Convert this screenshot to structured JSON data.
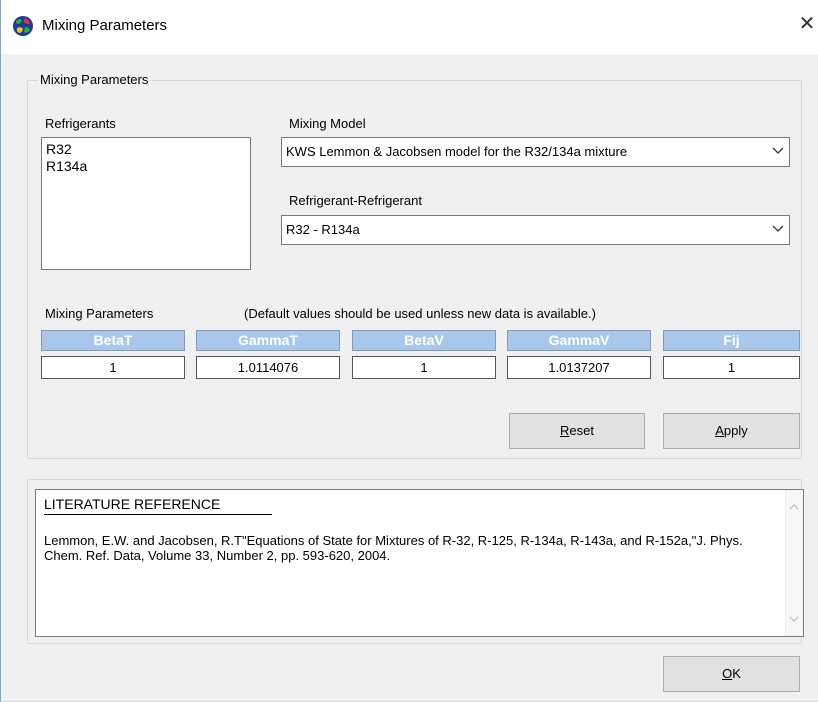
{
  "window": {
    "title": "Mixing Parameters",
    "close_glyph": "✕"
  },
  "group": {
    "label": "Mixing Parameters"
  },
  "refrigerants": {
    "label": "Refrigerants",
    "items": [
      "R32",
      "R134a"
    ]
  },
  "mixing_model": {
    "label": "Mixing Model",
    "value": "KWS  Lemmon & Jacobsen model for the R32/134a mixture"
  },
  "pair": {
    "label": "Refrigerant-Refrigerant",
    "value": "R32 - R134a"
  },
  "params": {
    "label": "Mixing Parameters",
    "note": "(Default values should be used unless new data is available.)",
    "columns": [
      {
        "header": "BetaT",
        "value": "1"
      },
      {
        "header": "GammaT",
        "value": "1.0114076"
      },
      {
        "header": "BetaV",
        "value": "1"
      },
      {
        "header": "GammaV",
        "value": "1.0137207"
      },
      {
        "header": "Fij",
        "value": "1"
      }
    ]
  },
  "buttons": {
    "reset": {
      "mnemonic": "R",
      "rest": "eset"
    },
    "apply": {
      "mnemonic": "A",
      "rest": "pply"
    },
    "ok": {
      "mnemonic": "O",
      "rest": "K"
    }
  },
  "reference": {
    "title": "LITERATURE REFERENCE",
    "text": "Lemmon, E.W. and Jacobsen, R.T\"Equations of State for Mixtures of R-32, R-125, R-134a, R-143a, and R-152a,\"J. Phys. Chem. Ref. Data, Volume 33, Number 2, pp. 593-620, 2004."
  },
  "icons": {
    "app": "globe-icon",
    "dropdown": "chevron-down-icon",
    "scroll_up": "scroll-up-icon",
    "scroll_down": "scroll-down-icon"
  },
  "colors": {
    "param_header_bg": "#a9c7ea",
    "param_header_text": "#ffffff"
  }
}
